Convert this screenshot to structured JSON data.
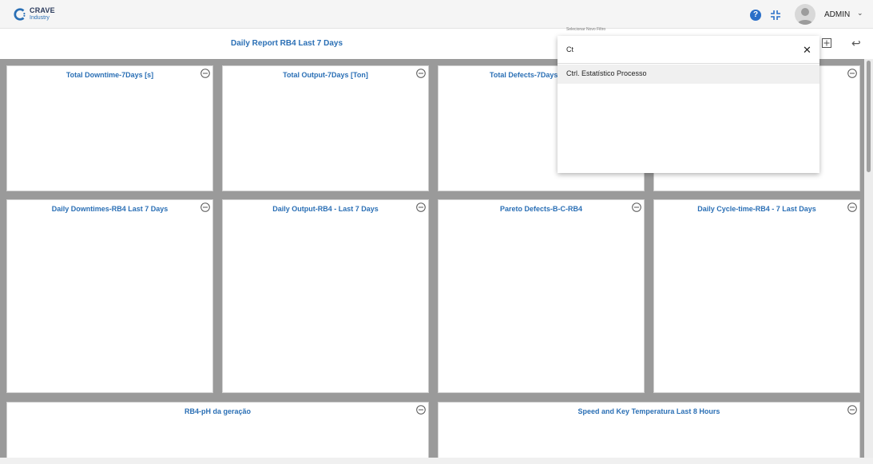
{
  "header": {
    "logo_name": "CRAVE",
    "logo_sub": "Industry",
    "help_label": "?",
    "user_name": "ADMIN"
  },
  "report": {
    "title": "Daily Report RB4 Last 7 Days"
  },
  "panels": [
    {
      "title": "Total Downtime-7Days [s]"
    },
    {
      "title": "Total Output-7Days [Ton]"
    },
    {
      "title": "Total Defects-7Days"
    },
    {
      "title": ""
    },
    {
      "title": "Daily Downtimes-RB4 Last 7 Days"
    },
    {
      "title": "Daily Output-RB4 - Last 7 Days"
    },
    {
      "title": "Pareto Defects-B-C-RB4"
    },
    {
      "title": "Daily Cycle-time-RB4 - 7 Last Days"
    },
    {
      "title": "RB4-pH da geração"
    },
    {
      "title": "Speed and Key Temperatura Last 8 Hours"
    }
  ],
  "filter": {
    "label": "Selecionar Novo Filtro",
    "value": "Ct",
    "options": [
      "Ctrl. Estatístico Processo"
    ]
  },
  "colors": {
    "accent": "#2a6fb5",
    "help": "#2a6fc8",
    "grid_background": "#9a9a9a"
  }
}
